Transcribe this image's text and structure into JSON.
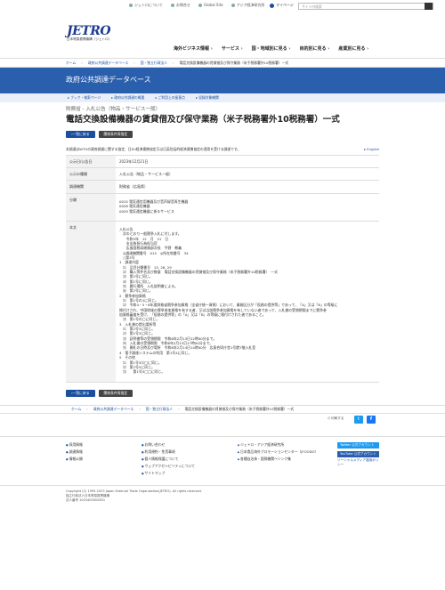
{
  "util": {
    "links": [
      "ジェトロについて",
      "お問合せ",
      "Global Site",
      "アジア経済研究所"
    ],
    "mypage": "マイページ",
    "search_placeholder": "サイト内検索"
  },
  "logo": {
    "mark": "JETRO",
    "sub": "日本貿易振興機構（ジェトロ）"
  },
  "mainnav": [
    "海外ビジネス情報",
    "サービス",
    "国・地域別に見る",
    "目的別に見る",
    "産業別に見る"
  ],
  "crumbs_top": [
    "ホーム",
    "政府公共調達データベース",
    "国・独立行政法人",
    "電話交換設備機器の賃貸借及び保守業務（米子税務署外10税務署）一式"
  ],
  "banner": "政府公共調達データベース",
  "subnav": [
    "ブック・検索ページ",
    "政府公共調達の概要",
    "ご利用上の留意点",
    "収録対象機関"
  ],
  "category": "財務省 - 入札公告（物品・サービス一般）",
  "title": "電話交換設備機器の賃貸借及び保守業務（米子税務署外10税務署）一式",
  "buttons": {
    "back": "一覧に戻る",
    "bidcond": "関係条件再指定"
  },
  "note": "本調達はWTOの政府調達に関する協定、日EU経済連携協定又は日英包括的経済連携協定の適用を受ける調達です。",
  "english": "English",
  "table": {
    "rows": [
      {
        "k": "公示日/公告日",
        "v": "2023年12月21日"
      },
      {
        "k": "公示の種類",
        "v": "入札公告（物品・サービス一般）"
      },
      {
        "k": "調達機関",
        "v": "財務省（広島県）"
      },
      {
        "k": "分類",
        "v": "0015 電気通信用機器及び音声録音再生機器\n0028 電気通信機器\n0029 電気通信機器に係るサービス"
      }
    ],
    "body_label": "本文",
    "body": "入札公告\n　次のとおり一般競争入札に付します。\n　　令和5年　12　月　21　日\n　　支出負担行為担当官\n　　広島国税局総務部次長　平野　教義\n　◎調達機関番号　015　◎所在地番号　34\n　○第3号\n1　調達内容\n　⑴　品目分類番号　15, 28, 29\n　⑵　購入等件名及び数量　電話交換設備機器の賃貸借及び保守業務（米子税務署外10税務署）　一式\n　⑶　第2号に同じ。\n　⑷　第1号に同じ。\n　⑸　履行場所　入札説明書による。\n　⑹　第2号に同じ。\n2　競争参加資格\n　⑴　第1号の1に同じ。\n　⑵　令和4・5・6年度財務省競争参加資格（全省庁統一資格）において、業務区分が「役務の提供等」であって、「A」又は「B」の等級に\n格付けされ、中国地域の競争参加資格を有する者、又は当該競争参加資格を有していない者であって、入札書の受領期限までに競争参\n加資格審査を受け、「役務の提供等」の「A」又は「B」の等級に格付けされた者であること。\n　⑶　第1号の□に同じ。\n3　入札書の提出場所等\n　⑴　第2号3に同じ。\n　⑵　第1号3に同じ。\n　⑶　証明書等の受領期限　令和6年2月13日12時00分まで。\n　⑷　入札書の受領期限　令和6年2月13日17時00分まで。\n　⑸　開札の日時及び場所　令和6年2月14日14時00分　広島合同庁舎1号館7階入札室\n4　電子調達システムの利用　第1号4に同じ。\n5　その他\n　⑴　第1号5⑴□に同じ。\n　⑵　第2号5に同じ。\n　⑶　　第1号5□□に同じ。"
  },
  "crumbs_bottom": [
    "ホーム",
    "政府公共調達データベース",
    "国・独立行政法人",
    "電話交換設備機器の賃貸借及び保守業務（米子税務署外10税務署）一式"
  ],
  "share": {
    "print": "印刷する"
  },
  "footer": {
    "col1": [
      "採用情報",
      "調達情報",
      "情報公開"
    ],
    "col2": [
      "お問い合わせ",
      "利用規約・免責事項",
      "個人情報保護について",
      "ウェブアクセシビリティについて",
      "サイトマップ"
    ],
    "col3": [
      "ジェトロ・アジア経済研究所",
      "日本食品海外プロモーションセンター（JFOODO）",
      "各種自治体・国際機関ヘリンク集"
    ],
    "social": [
      "Twitter 公式アカウント",
      "YouTube 公式アカウント",
      "ソーシャルメディア運用ポリシー"
    ]
  },
  "copyright": "Copyright (C) 1995-2023 Japan External Trade Organization(JETRO). All rights reserved.\n独立行政法人日本貿易振興機構\n法人番号 1010405002651"
}
